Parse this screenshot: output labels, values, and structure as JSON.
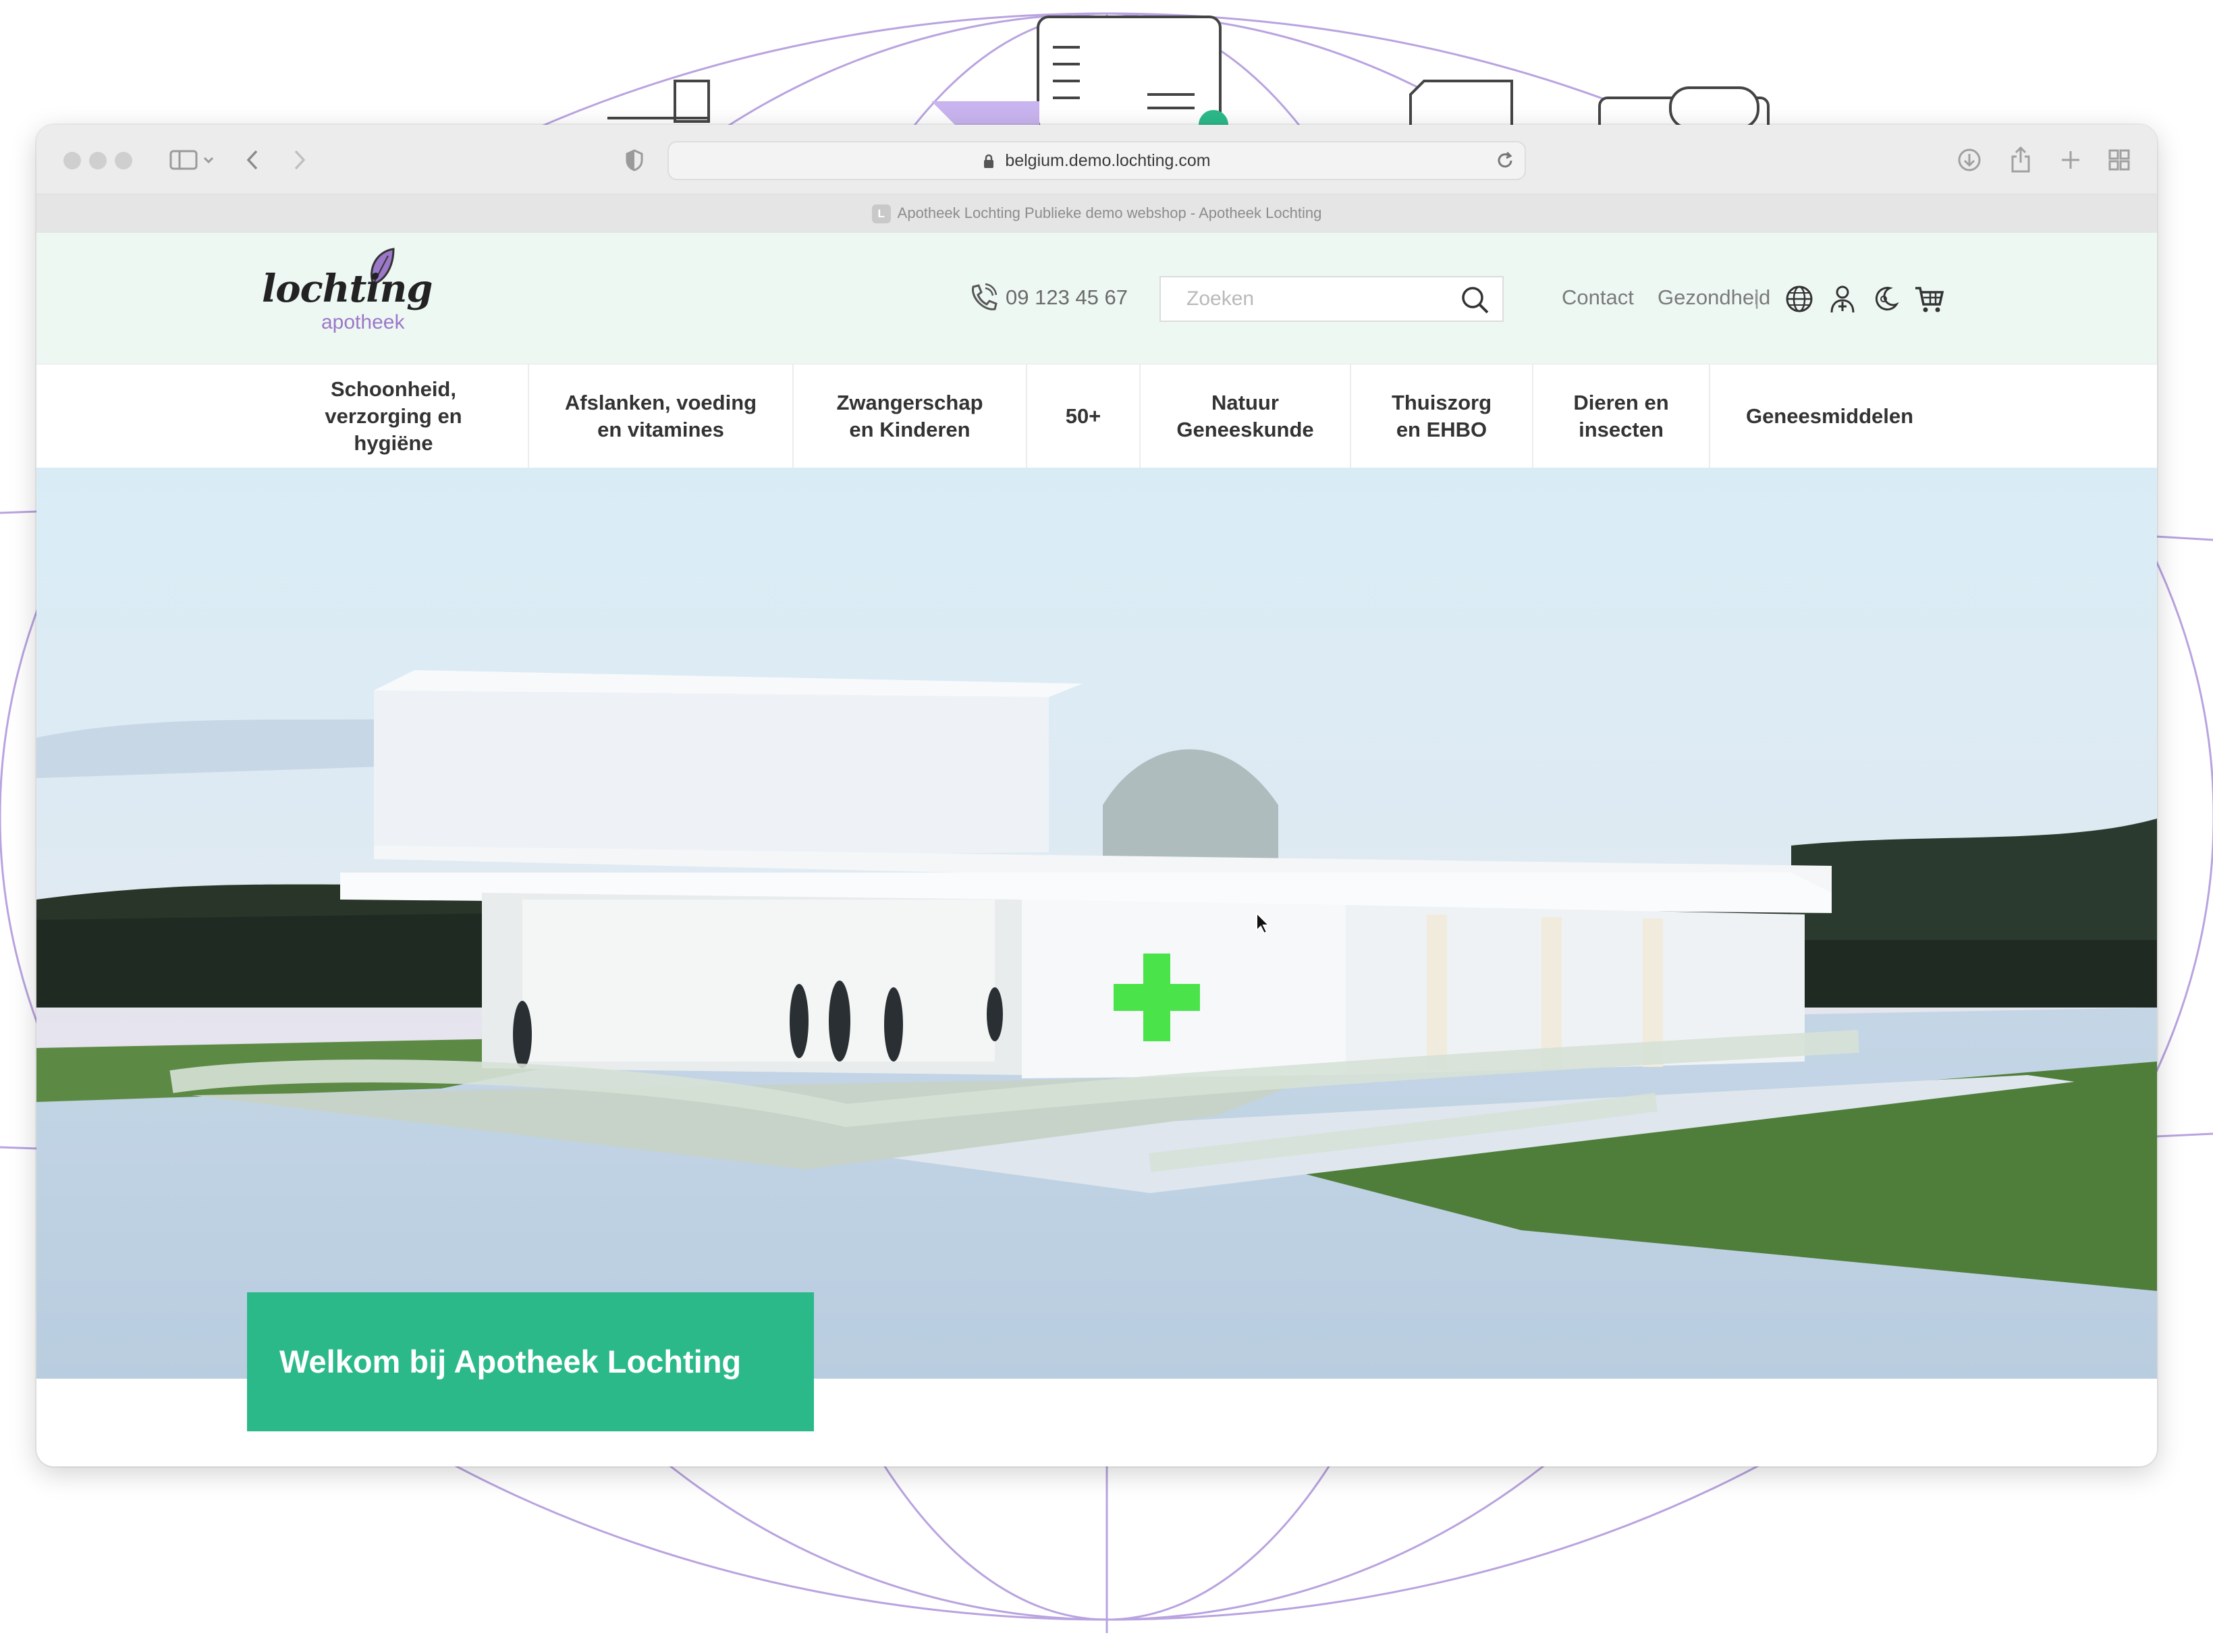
{
  "browser": {
    "url": "belgium.demo.lochting.com",
    "tab_title": "Apotheek Lochting Publieke demo webshop - Apotheek Lochting",
    "favicon_letter": "L"
  },
  "header": {
    "logo_word": "lochting",
    "logo_sub": "apotheek",
    "phone": "09 123 45 67",
    "search_placeholder": "Zoeken",
    "links": [
      "Contact",
      "Gezondheid"
    ],
    "separator": "|",
    "icons": [
      "globe-icon",
      "pharmacist-icon",
      "night-moon-icon",
      "cart-icon"
    ]
  },
  "nav": {
    "items": [
      "Schoonheid,\nverzorging en\nhygiëne",
      "Afslanken, voeding\nen vitamines",
      "Zwangerschap\nen Kinderen",
      "50+",
      "Natuur\nGeneeskunde",
      "Thuiszorg\nen EHBO",
      "Dieren en\ninsecten",
      "Geneesmiddelen"
    ]
  },
  "hero": {
    "welcome_title": "Welkom bij Apotheek Lochting",
    "cross_color": "#4ae34a"
  },
  "colors": {
    "accent": "#2bb98a",
    "header_bg": "#eef8f3",
    "logo_purple": "#9b78c9"
  }
}
